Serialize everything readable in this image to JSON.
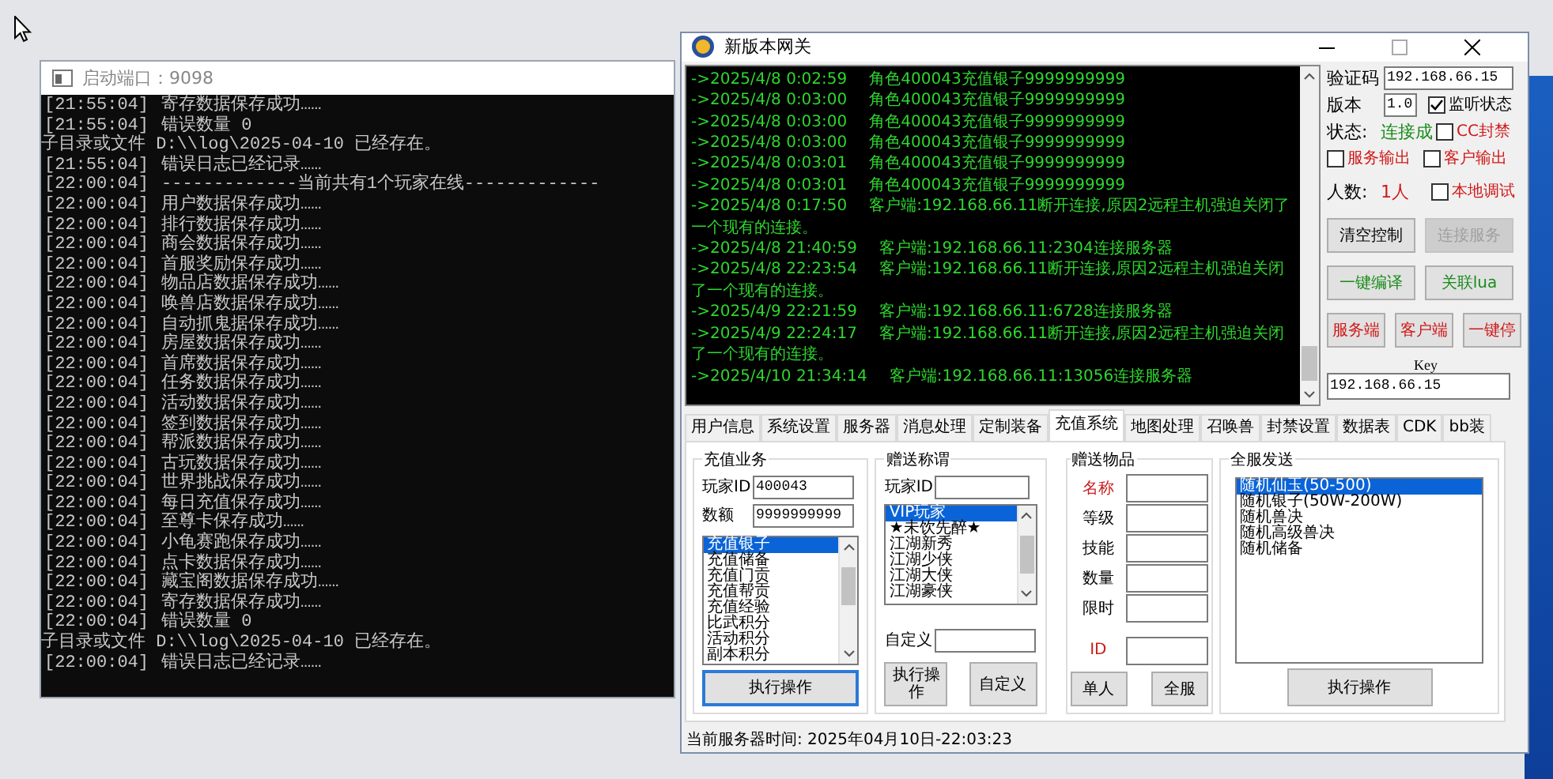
{
  "console": {
    "title": "启动端口：9098",
    "lines": [
      {
        "time": "[21:55:04]",
        "text": "寄存数据保存成功……"
      },
      {
        "time": "[21:55:04]",
        "text": "错误数量 0"
      },
      {
        "text": "子目录或文件 D:\\\\log\\2025-04-10 已经存在。"
      },
      {
        "time": "[21:55:04]",
        "text": "错误日志已经记录……"
      },
      {
        "time": "[22:00:04]",
        "text": "-------------当前共有1个玩家在线-------------"
      },
      {
        "time": "[22:00:04]",
        "text": "用户数据保存成功……"
      },
      {
        "time": "[22:00:04]",
        "text": "排行数据保存成功……"
      },
      {
        "time": "[22:00:04]",
        "text": "商会数据保存成功……"
      },
      {
        "time": "[22:00:04]",
        "text": "首服奖励保存成功……"
      },
      {
        "time": "[22:00:04]",
        "text": "物品店数据保存成功……"
      },
      {
        "time": "[22:00:04]",
        "text": "唤兽店数据保存成功……"
      },
      {
        "time": "[22:00:04]",
        "text": "自动抓鬼据保存成功……"
      },
      {
        "time": "[22:00:04]",
        "text": "房屋数据保存成功……"
      },
      {
        "time": "[22:00:04]",
        "text": "首席数据保存成功……"
      },
      {
        "time": "[22:00:04]",
        "text": "任务数据保存成功……"
      },
      {
        "time": "[22:00:04]",
        "text": "活动数据保存成功……"
      },
      {
        "time": "[22:00:04]",
        "text": "签到数据保存成功……"
      },
      {
        "time": "[22:00:04]",
        "text": "帮派数据保存成功……"
      },
      {
        "time": "[22:00:04]",
        "text": "古玩数据保存成功……"
      },
      {
        "time": "[22:00:04]",
        "text": "世界挑战保存成功……"
      },
      {
        "time": "[22:00:04]",
        "text": "每日充值保存成功……"
      },
      {
        "time": "[22:00:04]",
        "text": "至尊卡保存成功……"
      },
      {
        "time": "[22:00:04]",
        "text": "小龟赛跑保存成功……"
      },
      {
        "time": "[22:00:04]",
        "text": "点卡数据保存成功……"
      },
      {
        "time": "[22:00:04]",
        "text": "藏宝阁数据保存成功……"
      },
      {
        "time": "[22:00:04]",
        "text": "寄存数据保存成功……"
      },
      {
        "time": "[22:00:04]",
        "text": "错误数量 0"
      },
      {
        "text": "子目录或文件 D:\\\\log\\2025-04-10 已经存在。"
      },
      {
        "time": "[22:00:04]",
        "text": "错误日志已经记录……"
      }
    ]
  },
  "gateway": {
    "title": "新版本网关",
    "log": [
      {
        "time": "->2025/4/8 0:02:59",
        "text": "角色400043充值银子9999999999"
      },
      {
        "time": "->2025/4/8 0:03:00",
        "text": "角色400043充值银子9999999999"
      },
      {
        "time": "->2025/4/8 0:03:00",
        "text": "角色400043充值银子9999999999"
      },
      {
        "time": "->2025/4/8 0:03:00",
        "text": "角色400043充值银子9999999999"
      },
      {
        "time": "->2025/4/8 0:03:01",
        "text": "角色400043充值银子9999999999"
      },
      {
        "time": "->2025/4/8 0:03:01",
        "text": "角色400043充值银子9999999999"
      },
      {
        "time": "->2025/4/8 0:17:50",
        "text": "客户端:192.168.66.11断开连接,原因2远程主机强迫关闭了一个现有的连接。"
      },
      {
        "time": "->2025/4/8 21:40:59",
        "text": "客户端:192.168.66.11:2304连接服务器"
      },
      {
        "time": "->2025/4/8 22:23:54",
        "text": "客户端:192.168.66.11断开连接,原因2远程主机强迫关闭了一个现有的连接。"
      },
      {
        "time": "->2025/4/9 22:21:59",
        "text": "客户端:192.168.66.11:6728连接服务器"
      },
      {
        "time": "->2025/4/9 22:24:17",
        "text": "客户端:192.168.66.11断开连接,原因2远程主机强迫关闭了一个现有的连接。"
      },
      {
        "time": "->2025/4/10 21:34:14",
        "text": "客户端:192.168.66.11:13056连接服务器"
      }
    ],
    "side": {
      "code": {
        "label": "验证码",
        "value": "192.168.66.15"
      },
      "version": {
        "label": "版本",
        "value": "1.0"
      },
      "status": {
        "label": "状态:",
        "value": "连接成"
      },
      "count": {
        "label": "人数:",
        "value": "1人"
      },
      "checks": [
        {
          "label": "监听状态",
          "checked": true,
          "color": "#000000"
        },
        {
          "label": "CC封禁",
          "checked": false,
          "color": "#d01818"
        },
        {
          "label": "服务输出",
          "checked": false,
          "color": "#d01818"
        },
        {
          "label": "客户输出",
          "checked": false,
          "color": "#d01818"
        },
        {
          "label": "本地调试",
          "checked": false,
          "color": "#d01818"
        }
      ],
      "buttons": [
        {
          "label": "清空控制",
          "disabled": false,
          "color": "#000000"
        },
        {
          "label": "连接服务",
          "disabled": true,
          "color": "#a0a0a0"
        },
        {
          "label": "一键编译",
          "disabled": false,
          "color": "#1a8c1a"
        },
        {
          "label": "关联lua",
          "disabled": false,
          "color": "#1a8c1a"
        },
        {
          "label": "服务端",
          "disabled": false,
          "color": "#d01818"
        },
        {
          "label": "客户端",
          "disabled": false,
          "color": "#d01818"
        },
        {
          "label": "一键停",
          "disabled": false,
          "color": "#d01818"
        }
      ],
      "key": {
        "label": "Key",
        "value": "192.168.66.15"
      }
    },
    "tabs": [
      {
        "label": "用户信息",
        "selected": false
      },
      {
        "label": "系统设置",
        "selected": false
      },
      {
        "label": "服务器",
        "selected": false
      },
      {
        "label": "消息处理",
        "selected": false
      },
      {
        "label": "定制装备",
        "selected": false
      },
      {
        "label": "充值系统",
        "selected": true
      },
      {
        "label": "地图处理",
        "selected": false
      },
      {
        "label": "召唤兽",
        "selected": false
      },
      {
        "label": "封禁设置",
        "selected": false
      },
      {
        "label": "数据表",
        "selected": false
      },
      {
        "label": "CDK",
        "selected": false
      },
      {
        "label": "bb装",
        "selected": false
      }
    ],
    "recharge": {
      "title": "充值业务",
      "fields": [
        {
          "label": "玩家ID",
          "value": "400043"
        },
        {
          "label": "数额",
          "value": "9999999999"
        }
      ],
      "items": [
        {
          "label": "充值银子",
          "selected": true
        },
        {
          "label": "充值储备",
          "selected": false
        },
        {
          "label": "充值门贡",
          "selected": false
        },
        {
          "label": "充值帮贡",
          "selected": false
        },
        {
          "label": "充值经验",
          "selected": false
        },
        {
          "label": "比武积分",
          "selected": false
        },
        {
          "label": "活动积分",
          "selected": false
        },
        {
          "label": "副本积分",
          "selected": false
        }
      ],
      "button": "执行操作"
    },
    "title_gift": {
      "title": "赠送称谓",
      "player_label": "玩家ID",
      "items": [
        {
          "label": "VIP玩家",
          "selected": true
        },
        {
          "label": "★未饮先醉★",
          "selected": false
        },
        {
          "label": "江湖新秀",
          "selected": false
        },
        {
          "label": "江湖少侠",
          "selected": false
        },
        {
          "label": "江湖大侠",
          "selected": false
        },
        {
          "label": "江湖豪侠",
          "selected": false
        }
      ],
      "custom_label": "自定义",
      "buttons": [
        "执行操作",
        "自定义"
      ]
    },
    "item_gift": {
      "title": "赠送物品",
      "fields": [
        {
          "label": "名称",
          "color": "#c81e1e"
        },
        {
          "label": "等级",
          "color": "#000000"
        },
        {
          "label": "技能",
          "color": "#000000"
        },
        {
          "label": "数量",
          "color": "#000000"
        },
        {
          "label": "限时",
          "color": "#000000"
        },
        {
          "label": "ID",
          "color": "#c81e1e"
        }
      ],
      "buttons": [
        "单人",
        "全服"
      ]
    },
    "broadcast": {
      "title": "全服发送",
      "items": [
        {
          "label": "随机仙玉(50-500)",
          "selected": true
        },
        {
          "label": "随机银子(50W-200W)",
          "selected": false
        },
        {
          "label": "随机兽决",
          "selected": false
        },
        {
          "label": "随机高级兽决",
          "selected": false
        },
        {
          "label": "随机储备",
          "selected": false
        }
      ],
      "button": "执行操作"
    },
    "status_bar": "当前服务器时间: 2025年04月10日-22:03:23"
  }
}
